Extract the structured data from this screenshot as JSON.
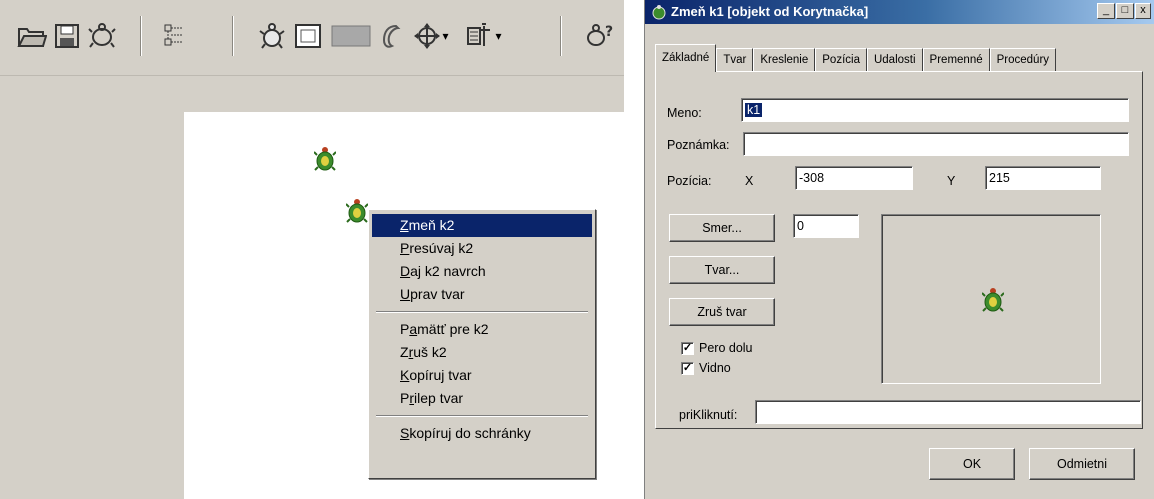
{
  "toolbar": {
    "icons": [
      "open-folder-icon",
      "save-icon",
      "turtle-tool-icon",
      "tree-icon",
      "new-turtle-icon",
      "window-icon",
      "panel-icon",
      "pen-icon",
      "move-icon",
      "properties-icon",
      "help-icon"
    ],
    "dropdown_glyph": "▾"
  },
  "context_menu": {
    "items": [
      {
        "pre": "",
        "ul": "Z",
        "post": "meň k2"
      },
      {
        "pre": "",
        "ul": "P",
        "post": "resúvaj k2"
      },
      {
        "pre": "",
        "ul": "D",
        "post": "aj k2 navrch"
      },
      {
        "pre": "",
        "ul": "U",
        "post": "prav tvar"
      },
      {
        "pre": "P",
        "ul": "a",
        "post": "mätť pre k2"
      },
      {
        "pre": "Z",
        "ul": "r",
        "post": "uš k2"
      },
      {
        "pre": "",
        "ul": "K",
        "post": "opíruj tvar"
      },
      {
        "pre": "P",
        "ul": "r",
        "post": "ilep tvar"
      },
      {
        "pre": "",
        "ul": "S",
        "post": "kopíruj do schránky"
      }
    ]
  },
  "dialog": {
    "title": "Zmeň k1 [objekt od Korytnačka]",
    "title_buttons": [
      "_",
      "□",
      "x"
    ],
    "tabs": [
      "Základné",
      "Tvar",
      "Kreslenie",
      "Pozícia",
      "Udalosti",
      "Premenné",
      "Procedúry"
    ],
    "fields": {
      "name_label": "Meno:",
      "name_value": "k1",
      "note_label": "Poznámka:",
      "note_value": "",
      "position_label": "Pozícia:",
      "x_label": "X",
      "x_value": "-308",
      "y_label": "Y",
      "y_value": "215",
      "direction_value": "0",
      "on_click_label": "priKliknutí:",
      "on_click_value": ""
    },
    "buttons": {
      "direction": "Smer...",
      "shape": "Tvar...",
      "cancel_shape": "Zruš tvar",
      "ok": "OK",
      "cancel": "Odmietni"
    },
    "checkboxes": [
      {
        "label": "Pero dolu",
        "checked": true
      },
      {
        "label": "Vidno",
        "checked": true
      }
    ],
    "check_glyph": "✓"
  },
  "colors": {
    "window_face": "#d4d0c8",
    "highlight": "#0a246a",
    "turtle_shell": "#3c8c2c"
  }
}
